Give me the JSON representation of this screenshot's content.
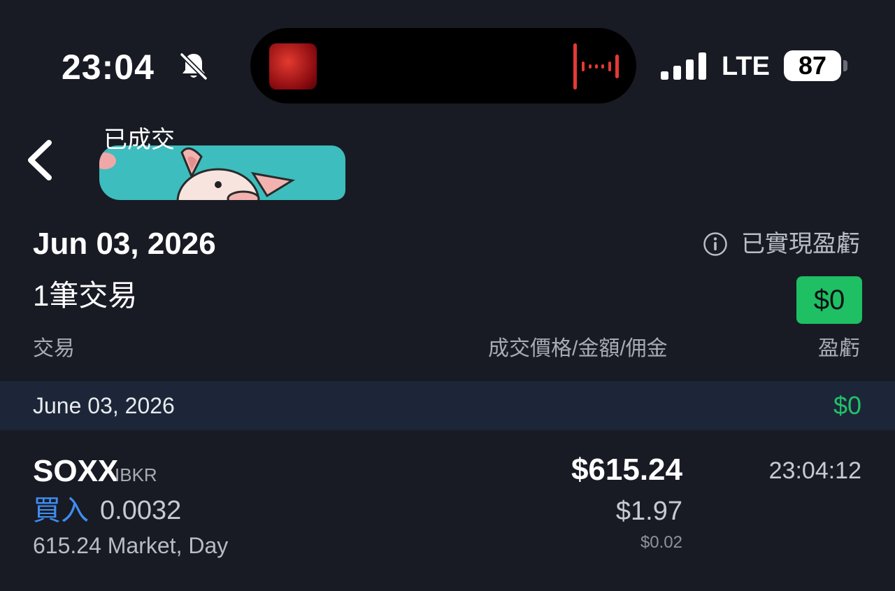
{
  "status_bar": {
    "time": "23:04",
    "network": "LTE",
    "battery": "87"
  },
  "header": {
    "title": "已成交"
  },
  "summary": {
    "date": "Jun 03, 2026",
    "trade_count": "1筆交易",
    "realized_label": "已實現盈虧",
    "realized_pnl": "$0"
  },
  "columns": {
    "trade": "交易",
    "price": "成交價格/金額/佣金",
    "pnl": "盈虧"
  },
  "group": {
    "date": "June 03, 2026",
    "pnl": "$0"
  },
  "trade": {
    "ticker": "SOXX",
    "broker": "IBKR",
    "side": "買入",
    "quantity": "0.0032",
    "order": "615.24 Market, Day",
    "price": "$615.24",
    "amount": "$1.97",
    "commission": "$0.02",
    "time": "23:04:12"
  },
  "colors": {
    "background": "#181b24",
    "positive": "#22c06a",
    "buy": "#3f8df0",
    "band": "#1c2638"
  }
}
